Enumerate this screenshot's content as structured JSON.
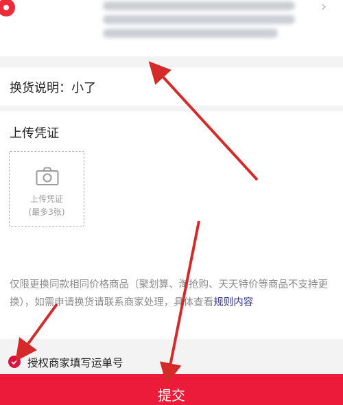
{
  "address": {
    "pin_icon": "location-pin-icon",
    "chevron_icon": "chevron-right-icon",
    "chevron_glyph": "›"
  },
  "exchange_explanation": {
    "label": "换货说明：",
    "value": "小了"
  },
  "upload": {
    "title": "上传凭证",
    "button_label": "上传凭证",
    "button_hint": "(最多3张)",
    "icon": "camera-icon"
  },
  "notice": {
    "text": "仅限更换同款相同价格商品（聚划算、淘抢购、天天特价等商品不支持更换），如需申请换货请联系商家处理，具体查看",
    "link": "规则内容"
  },
  "authorize": {
    "checked": true,
    "label": "授权商家填写运单号"
  },
  "submit": {
    "label": "提交"
  },
  "colors": {
    "accent": "#ed1b3a",
    "link": "#2c2f8e",
    "annotation_arrow": "#d42a2a"
  }
}
